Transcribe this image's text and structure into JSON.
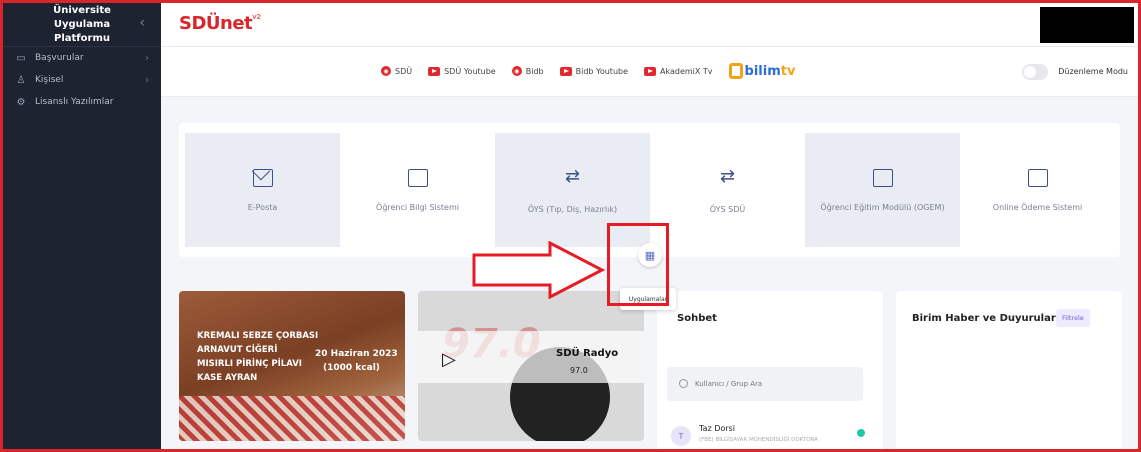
{
  "sidebar": {
    "title": "Üniversite Uygulama\nPlatformu",
    "items": [
      {
        "label": "Başvurular",
        "icon": "inbox-icon",
        "has_children": true
      },
      {
        "label": "Kişisel",
        "icon": "user-icon",
        "has_children": true
      },
      {
        "label": "Lisanslı Yazılımlar",
        "icon": "gear-icon",
        "has_children": false
      }
    ]
  },
  "header": {
    "logo": "SDÜnet",
    "logo_sup": "v2"
  },
  "quick_links": [
    {
      "label": "SDÜ",
      "icon": "sdu-radio-icon"
    },
    {
      "label": "SDÜ Youtube",
      "icon": "youtube-icon"
    },
    {
      "label": "Bidb",
      "icon": "bidb-radio-icon"
    },
    {
      "label": "Bidb Youtube",
      "icon": "youtube-icon"
    },
    {
      "label": "AkademiX Tv",
      "icon": "youtube-icon"
    }
  ],
  "bilimtv": {
    "part1": "bilim",
    "part2": "tv"
  },
  "edit_mode": {
    "label": "Düzenleme Modu",
    "enabled": false
  },
  "apps": [
    {
      "label": "E-Posta",
      "icon": "mail-icon"
    },
    {
      "label": "Öğrenci Bilgi Sistemi",
      "icon": "id-card-icon"
    },
    {
      "label": "ÖYS (Tıp, Diş, Hazırlık)",
      "icon": "transfer-arrows-icon"
    },
    {
      "label": "ÖYS SDÜ",
      "icon": "transfer-arrows-icon"
    },
    {
      "label": "Öğrenci Eğitim Modülü (OGEM)",
      "icon": "education-icon"
    },
    {
      "label": "Online Ödeme Sistemi",
      "icon": "credit-card-icon"
    }
  ],
  "apps_tooltip": "Uygulamalar",
  "menu": {
    "items": [
      "KREMALI SEBZE ÇORBASI",
      "ARNAVUT CİĞERİ",
      "MISIRLI PİRİNÇ PİLAVI",
      "KASE AYRAN"
    ],
    "date": "20 Haziran 2023",
    "kcal": "(1000 kcal)"
  },
  "radio": {
    "name": "SDÜ Radyo",
    "frequency": "97.0",
    "bg_text": "97.0"
  },
  "chat": {
    "title": "Sohbet",
    "search_placeholder": "Kullanıcı / Grup Ara",
    "users": [
      {
        "initial": "T",
        "name": "Taz Dorsi",
        "dept": "(FBE) BİLGİSAYAR MÜHENDİSLİĞİ DOKTORA",
        "online": true
      }
    ]
  },
  "news": {
    "title": "Birim Haber ve Duyuruları",
    "filter_label": "Filtrele"
  },
  "colors": {
    "brand_red": "#d8262a",
    "sidebar_bg": "#1e2332",
    "accent_purple": "#6b63d6",
    "online_green": "#1fc9a8"
  }
}
